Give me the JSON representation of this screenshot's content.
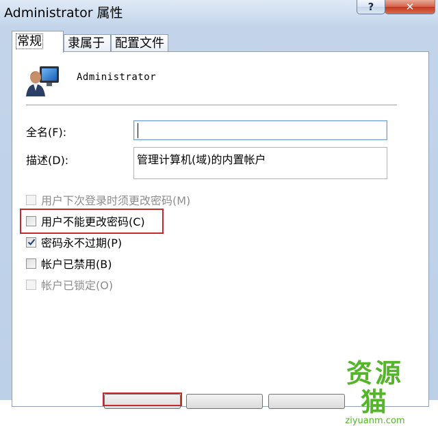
{
  "window": {
    "title": "Administrator 属性",
    "help_label": "?",
    "close_label": "✕"
  },
  "tabs": [
    {
      "label": "常规",
      "active": true
    },
    {
      "label": "隶属于",
      "active": false
    },
    {
      "label": "配置文件",
      "active": false
    }
  ],
  "general": {
    "user_icon": "user-account-icon",
    "username": "Administrator",
    "fullname_label": "全名(F):",
    "fullname_value": "",
    "description_label": "描述(D):",
    "description_value": "管理计算机(域)的内置帐户"
  },
  "options": [
    {
      "label": "用户下次登录时须更改密码(M)",
      "checked": false,
      "enabled": false
    },
    {
      "label": "用户不能更改密码(C)",
      "checked": false,
      "enabled": true,
      "highlighted": true
    },
    {
      "label": "密码永不过期(P)",
      "checked": true,
      "enabled": true
    },
    {
      "label": "帐户已禁用(B)",
      "checked": false,
      "enabled": true
    },
    {
      "label": "帐户已锁定(O)",
      "checked": false,
      "enabled": false
    }
  ],
  "watermark": {
    "text_cn": "资源猫",
    "text_en": "ziyuanm.com"
  },
  "colors": {
    "highlight": "#c8282b",
    "watermark": "#55b52a"
  }
}
